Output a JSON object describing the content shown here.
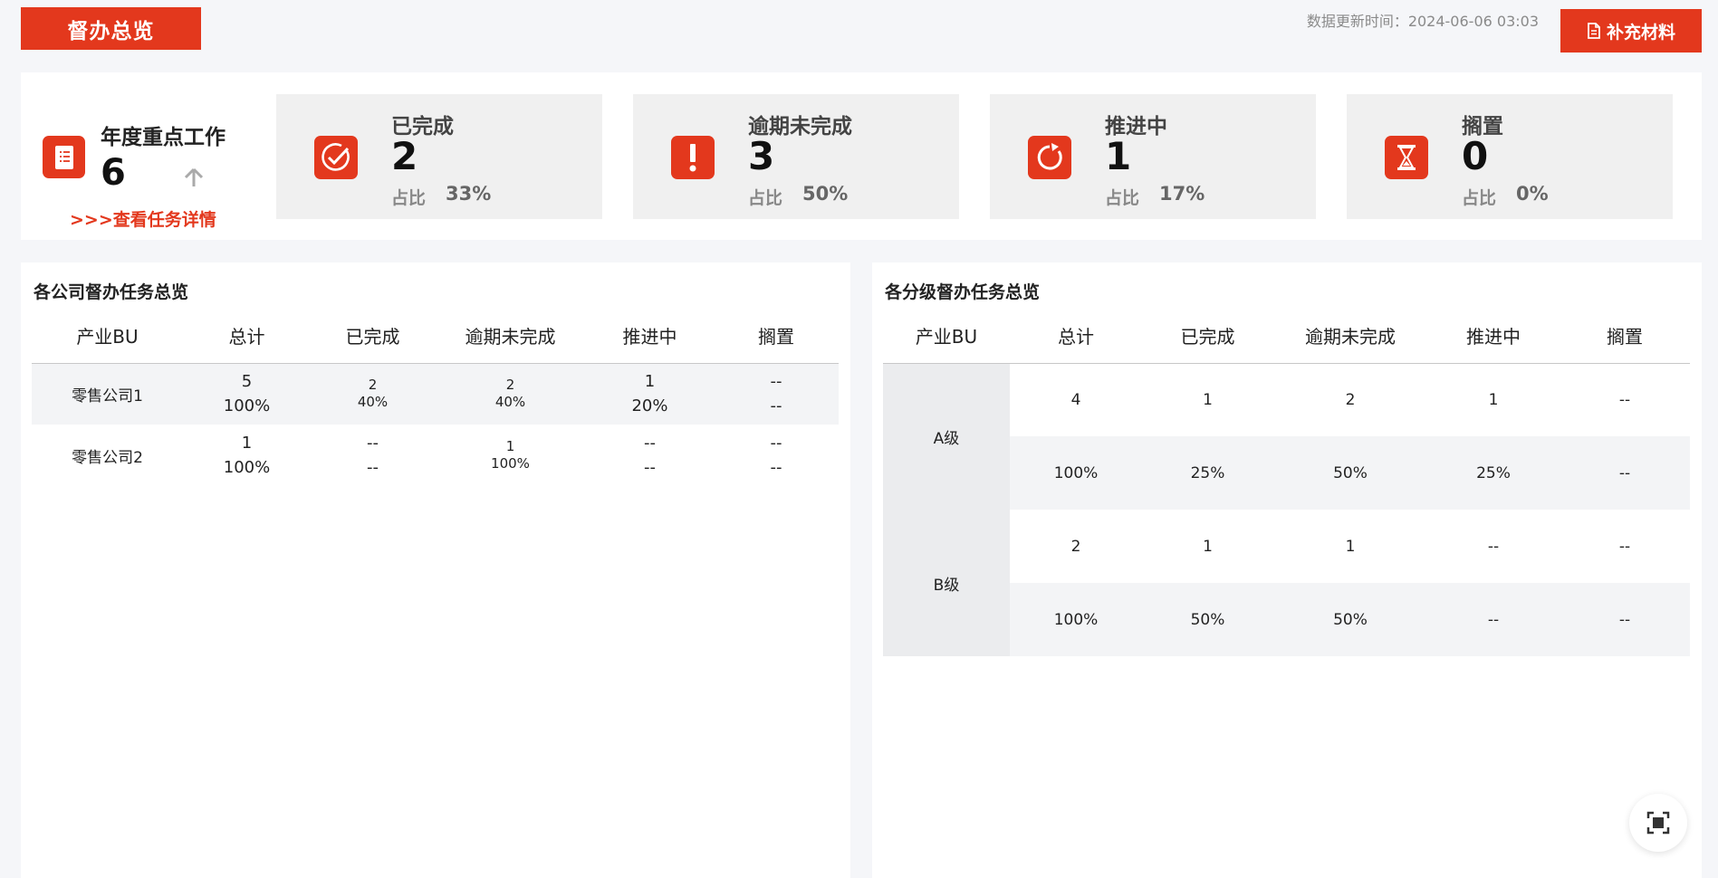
{
  "header": {
    "title": "督办总览",
    "update_time": "数据更新时间：2024-06-06 03:03",
    "supplement_label": "补充材料"
  },
  "summary": {
    "annual": {
      "label": "年度重点工作",
      "count": "6",
      "detail_link": ">>>查看任务详情"
    },
    "cards": [
      {
        "label": "已完成",
        "value": "2",
        "ratio_label": "占比",
        "ratio": "33%",
        "icon": "check-circle-icon"
      },
      {
        "label": "逾期未完成",
        "value": "3",
        "ratio_label": "占比",
        "ratio": "50%",
        "icon": "exclamation-icon"
      },
      {
        "label": "推进中",
        "value": "1",
        "ratio_label": "占比",
        "ratio": "17%",
        "icon": "refresh-icon"
      },
      {
        "label": "搁置",
        "value": "0",
        "ratio_label": "占比",
        "ratio": "0%",
        "icon": "hourglass-icon"
      }
    ]
  },
  "company_panel": {
    "title": "各公司督办任务总览",
    "headers": [
      "产业BU",
      "总计",
      "已完成",
      "逾期未完成",
      "推进中",
      "搁置"
    ],
    "rows": [
      {
        "name": "零售公司1",
        "total": [
          "5",
          "100%"
        ],
        "done": [
          "2",
          "40%"
        ],
        "overdue": [
          "2",
          "40%"
        ],
        "progress": [
          "1",
          "20%"
        ],
        "shelved": [
          "--",
          "--"
        ]
      },
      {
        "name": "零售公司2",
        "total": [
          "1",
          "100%"
        ],
        "done": [
          "--",
          "--"
        ],
        "overdue": [
          "1",
          "100%"
        ],
        "progress": [
          "--",
          "--"
        ],
        "shelved": [
          "--",
          "--"
        ]
      }
    ]
  },
  "grade_panel": {
    "title": "各分级督办任务总览",
    "headers": [
      "产业BU",
      "总计",
      "已完成",
      "逾期未完成",
      "推进中",
      "搁置"
    ],
    "grades": [
      {
        "name": "A级",
        "counts": [
          "4",
          "1",
          "2",
          "1",
          "--"
        ],
        "ratios": [
          "100%",
          "25%",
          "50%",
          "25%",
          "--"
        ]
      },
      {
        "name": "B级",
        "counts": [
          "2",
          "1",
          "1",
          "--",
          "--"
        ],
        "ratios": [
          "100%",
          "50%",
          "50%",
          "--",
          "--"
        ]
      }
    ]
  },
  "colors": {
    "accent": "#e3381d",
    "card_bg": "#f0f0f0",
    "page_bg": "#f5f6f9"
  }
}
